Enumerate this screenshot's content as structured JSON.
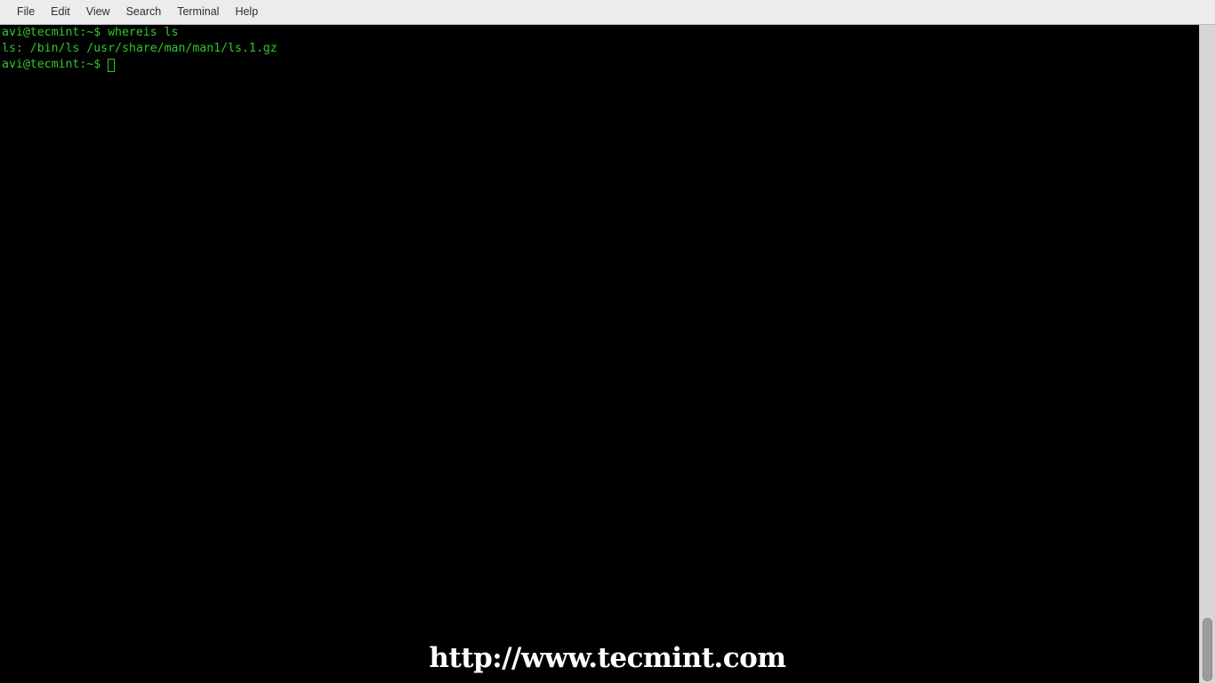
{
  "window": {
    "title": "Terminal",
    "background_color": "#000000",
    "menubar_color": "#ececec"
  },
  "menubar": {
    "items": [
      {
        "label": "File",
        "name": "menu-file"
      },
      {
        "label": "Edit",
        "name": "menu-edit"
      },
      {
        "label": "View",
        "name": "menu-view"
      },
      {
        "label": "Search",
        "name": "menu-search"
      },
      {
        "label": "Terminal",
        "name": "menu-terminal"
      },
      {
        "label": "Help",
        "name": "menu-help"
      }
    ]
  },
  "terminal": {
    "foreground_color": "#2fc72f",
    "background_color": "#000000",
    "lines": [
      {
        "text": "avi@tecmint:~$ whereis ls",
        "type": "command"
      },
      {
        "text": "ls: /bin/ls /usr/share/man/man1/ls.1.gz",
        "type": "output"
      }
    ],
    "prompt": "avi@tecmint:~$",
    "cursor": {
      "shape": "hollow-block",
      "color": "#2fc72f"
    }
  },
  "scrollbar": {
    "orientation": "vertical",
    "trough_color": "#d6d6d6",
    "thumb_color": "#9b9b9b",
    "position": "bottom"
  },
  "watermark": {
    "text": "http://www.tecmint.com",
    "color": "#ffffff"
  }
}
